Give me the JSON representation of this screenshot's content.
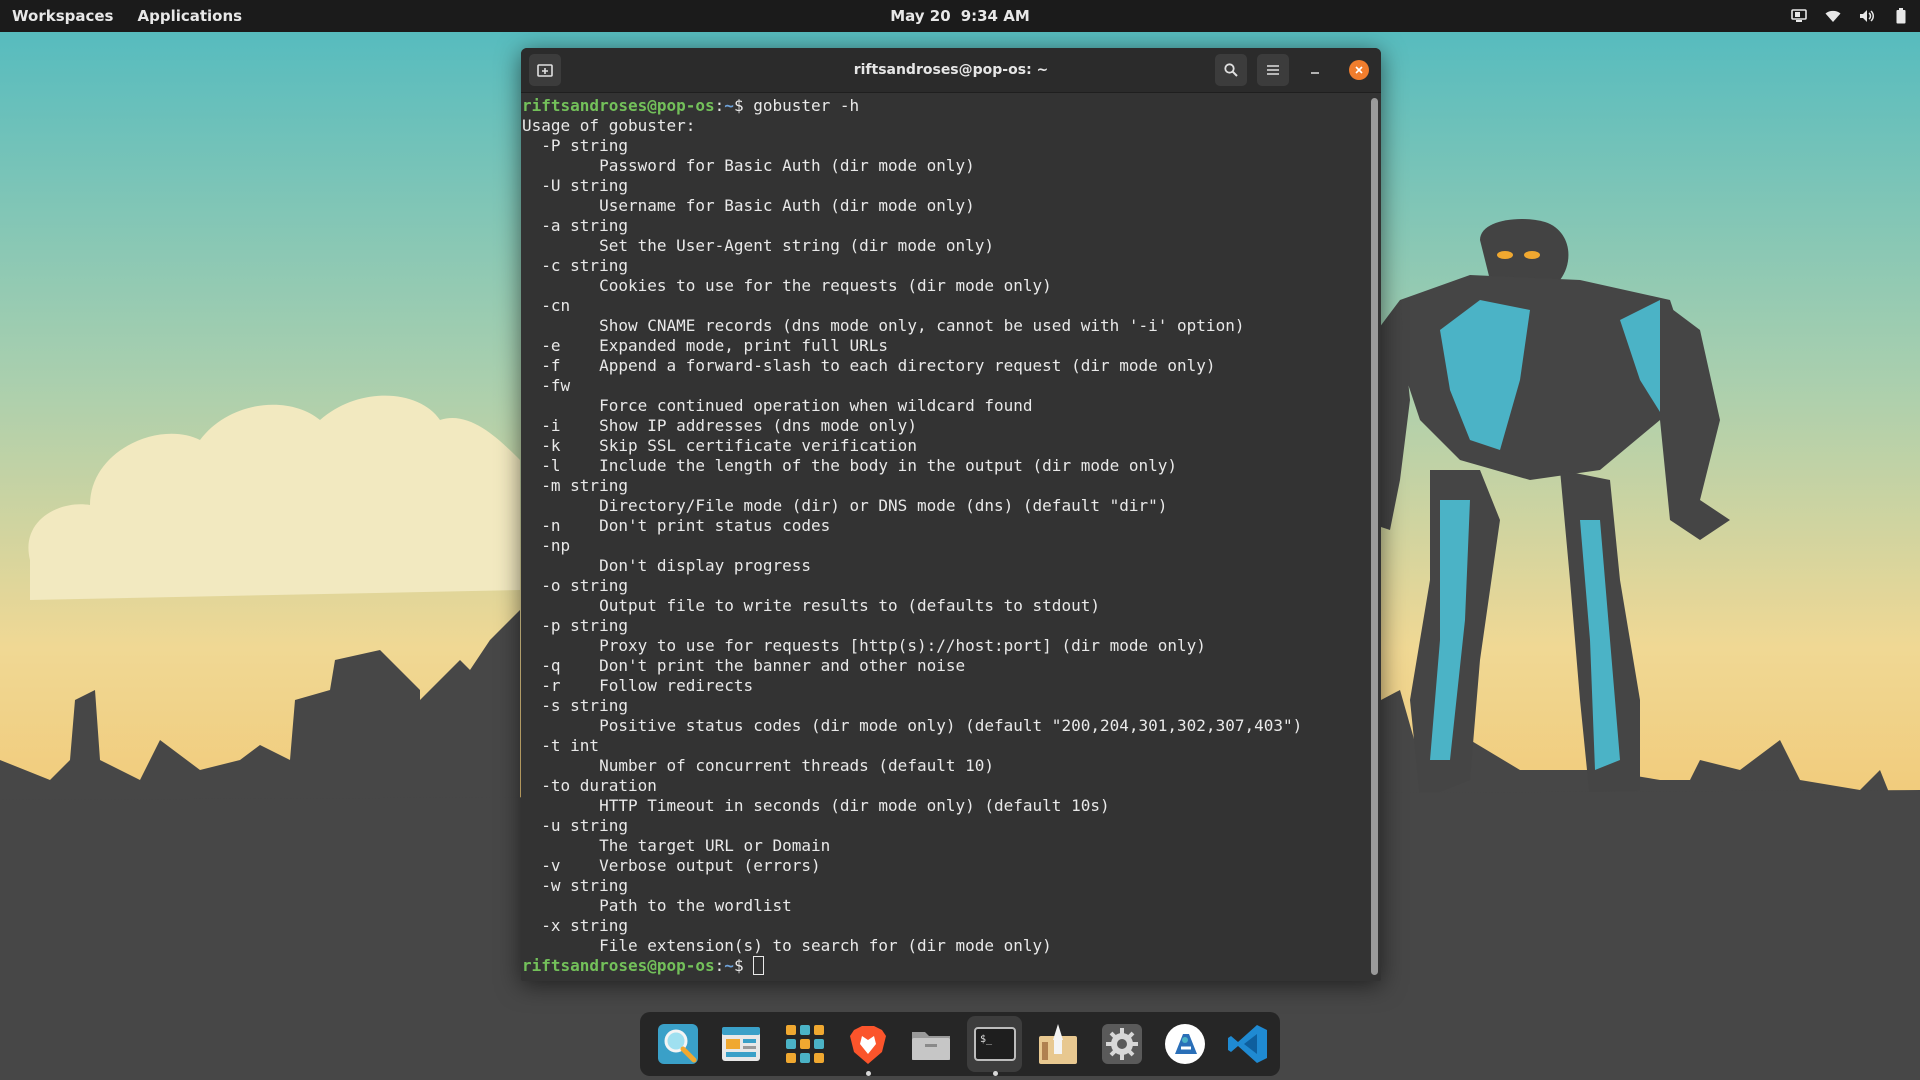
{
  "panel": {
    "workspaces": "Workspaces",
    "applications": "Applications",
    "date": "May 20",
    "time": "9:34 AM",
    "tray": [
      "display-icon",
      "wifi-icon",
      "volume-icon",
      "battery-icon"
    ]
  },
  "window": {
    "title": "riftsandroses@pop-os: ~"
  },
  "terminal": {
    "user_host": "riftsandroses@pop-os",
    "path": "~",
    "prompt_symbol": "$",
    "command": " gobuster -h",
    "lines": [
      "Usage of gobuster:",
      "  -P string",
      "        Password for Basic Auth (dir mode only)",
      "  -U string",
      "        Username for Basic Auth (dir mode only)",
      "  -a string",
      "        Set the User-Agent string (dir mode only)",
      "  -c string",
      "        Cookies to use for the requests (dir mode only)",
      "  -cn",
      "        Show CNAME records (dns mode only, cannot be used with '-i' option)",
      "  -e    Expanded mode, print full URLs",
      "  -f    Append a forward-slash to each directory request (dir mode only)",
      "  -fw",
      "        Force continued operation when wildcard found",
      "  -i    Show IP addresses (dns mode only)",
      "  -k    Skip SSL certificate verification",
      "  -l    Include the length of the body in the output (dir mode only)",
      "  -m string",
      "        Directory/File mode (dir) or DNS mode (dns) (default \"dir\")",
      "  -n    Don't print status codes",
      "  -np",
      "        Don't display progress",
      "  -o string",
      "        Output file to write results to (defaults to stdout)",
      "  -p string",
      "        Proxy to use for requests [http(s)://host:port] (dir mode only)",
      "  -q    Don't print the banner and other noise",
      "  -r    Follow redirects",
      "  -s string",
      "        Positive status codes (dir mode only) (default \"200,204,301,302,307,403\")",
      "  -t int",
      "        Number of concurrent threads (default 10)",
      "  -to duration",
      "        HTTP Timeout in seconds (dir mode only) (default 10s)",
      "  -u string",
      "        The target URL or Domain",
      "  -v    Verbose output (errors)",
      "  -w string",
      "        Path to the wordlist",
      "  -x string",
      "        File extension(s) to search for (dir mode only)"
    ]
  },
  "dock": {
    "items": [
      {
        "icon": "search-launcher-icon",
        "running": false,
        "active": false
      },
      {
        "icon": "pop-shop-icon",
        "running": false,
        "active": false
      },
      {
        "icon": "app-grid-icon",
        "running": false,
        "active": false
      },
      {
        "icon": "brave-browser-icon",
        "running": true,
        "active": false
      },
      {
        "icon": "files-icon",
        "running": false,
        "active": false
      },
      {
        "icon": "terminal-icon",
        "running": true,
        "active": true
      },
      {
        "icon": "installer-icon",
        "running": false,
        "active": false
      },
      {
        "icon": "settings-icon",
        "running": false,
        "active": false
      },
      {
        "icon": "app-store-icon",
        "running": false,
        "active": false
      },
      {
        "icon": "vscode-icon",
        "running": false,
        "active": false
      }
    ]
  }
}
